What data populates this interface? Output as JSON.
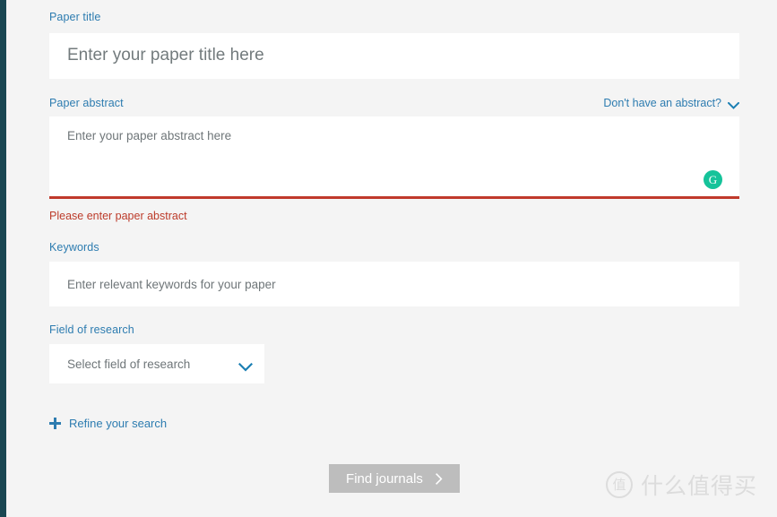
{
  "theme": {
    "background": "#f4f4f4",
    "rail_color": "#1a4752",
    "label_color": "#2d7cb0",
    "error_color": "#bc3b2a",
    "accent_green": "#15c39a",
    "button_disabled": "#bdbdbd"
  },
  "form": {
    "paper_title": {
      "label": "Paper title",
      "placeholder": "Enter your paper title here",
      "value": ""
    },
    "paper_abstract": {
      "label": "Paper abstract",
      "placeholder": "Enter your paper abstract here",
      "value": "",
      "helper_link": "Don't have an abstract?",
      "error": "Please enter paper abstract",
      "grammarly_badge": "G"
    },
    "keywords": {
      "label": "Keywords",
      "placeholder": "Enter relevant keywords for your paper",
      "value": ""
    },
    "field_of_research": {
      "label": "Field of research",
      "placeholder": "Select field of research",
      "selected": "Select field of research"
    },
    "refine": {
      "label": "Refine your search"
    },
    "submit": {
      "label": "Find journals"
    }
  },
  "watermark": {
    "mark": "值",
    "text": "什么值得买"
  }
}
